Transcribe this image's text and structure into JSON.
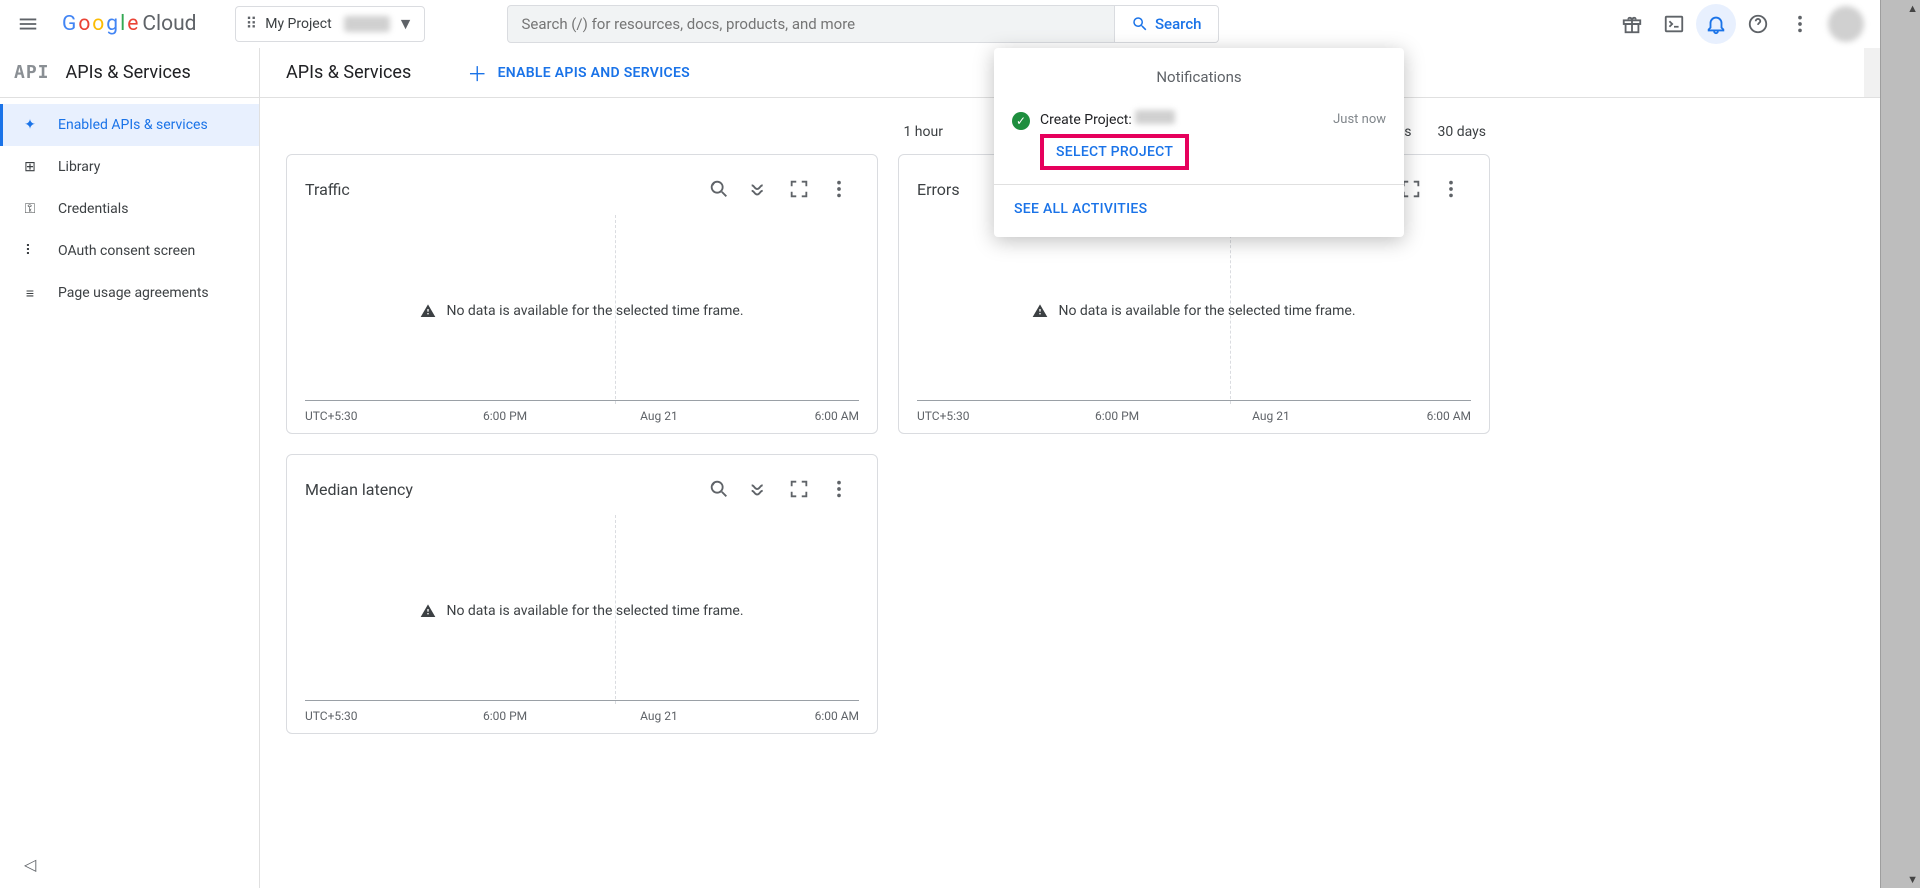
{
  "header": {
    "logo_cloud": "Cloud",
    "project_label": "My Project",
    "search_placeholder": "Search (/) for resources, docs, products, and more",
    "search_button": "Search"
  },
  "subheader": {
    "api_logo": "API",
    "title_left": "APIs & Services",
    "title_main": "APIs & Services",
    "enable_label": "ENABLE APIS AND SERVICES"
  },
  "sidenav": {
    "items": [
      {
        "label": "Enabled APIs & services"
      },
      {
        "label": "Library"
      },
      {
        "label": "Credentials"
      },
      {
        "label": "OAuth consent screen"
      },
      {
        "label": "Page usage agreements"
      }
    ]
  },
  "time_range": [
    "1 hour",
    "",
    "",
    "",
    "",
    "30 days"
  ],
  "time_range_hidden_30d_suffix": "ys",
  "cards": [
    {
      "title": "Traffic",
      "no_data": "No data is available for the selected time frame.",
      "xaxis": [
        "UTC+5:30",
        "6:00 PM",
        "Aug 21",
        "6:00 AM"
      ]
    },
    {
      "title": "Errors",
      "no_data": "No data is available for the selected time frame.",
      "xaxis": [
        "UTC+5:30",
        "6:00 PM",
        "Aug 21",
        "6:00 AM"
      ]
    },
    {
      "title": "Median latency",
      "no_data": "No data is available for the selected time frame.",
      "xaxis": [
        "UTC+5:30",
        "6:00 PM",
        "Aug 21",
        "6:00 AM"
      ]
    }
  ],
  "notifications": {
    "title": "Notifications",
    "item_label": "Create Project:",
    "item_time": "Just now",
    "select_project": "SELECT PROJECT",
    "see_all": "SEE ALL ACTIVITIES"
  },
  "chart_data": [
    {
      "type": "line",
      "title": "Traffic",
      "x": [
        "UTC+5:30",
        "6:00 PM",
        "Aug 21",
        "6:00 AM"
      ],
      "values": [],
      "note": "No data is available for the selected time frame."
    },
    {
      "type": "line",
      "title": "Errors",
      "x": [
        "UTC+5:30",
        "6:00 PM",
        "Aug 21",
        "6:00 AM"
      ],
      "values": [],
      "note": "No data is available for the selected time frame."
    },
    {
      "type": "line",
      "title": "Median latency",
      "x": [
        "UTC+5:30",
        "6:00 PM",
        "Aug 21",
        "6:00 AM"
      ],
      "values": [],
      "note": "No data is available for the selected time frame."
    }
  ]
}
